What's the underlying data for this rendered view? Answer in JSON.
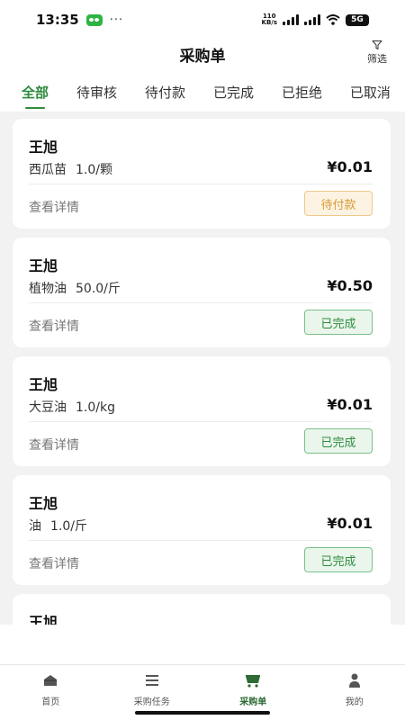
{
  "status_bar": {
    "time": "13:35",
    "dots": "···",
    "net_speed_value": "110",
    "net_speed_unit": "KB/s",
    "network": "5G"
  },
  "header": {
    "title": "采购单",
    "filter_label": "筛选"
  },
  "tabs": [
    {
      "label": "全部",
      "active": true
    },
    {
      "label": "待审核",
      "active": false
    },
    {
      "label": "待付款",
      "active": false
    },
    {
      "label": "已完成",
      "active": false
    },
    {
      "label": "已拒绝",
      "active": false
    },
    {
      "label": "已取消",
      "active": false
    }
  ],
  "orders": [
    {
      "buyer": "王旭",
      "product": "西瓜苗",
      "quantity": "1.0/颗",
      "price": "¥0.01",
      "detail_label": "查看详情",
      "status": "待付款"
    },
    {
      "buyer": "王旭",
      "product": "植物油",
      "quantity": "50.0/斤",
      "price": "¥0.50",
      "detail_label": "查看详情",
      "status": "已完成"
    },
    {
      "buyer": "王旭",
      "product": "大豆油",
      "quantity": "1.0/kg",
      "price": "¥0.01",
      "detail_label": "查看详情",
      "status": "已完成"
    },
    {
      "buyer": "王旭",
      "product": "油",
      "quantity": "1.0/斤",
      "price": "¥0.01",
      "detail_label": "查看详情",
      "status": "已完成"
    },
    {
      "buyer": "王旭"
    }
  ],
  "bottom_nav": [
    {
      "label": "首页",
      "icon": "home-icon",
      "active": false
    },
    {
      "label": "采购任务",
      "icon": "list-icon",
      "active": false
    },
    {
      "label": "采购单",
      "icon": "cart-icon",
      "active": true
    },
    {
      "label": "我的",
      "icon": "user-icon",
      "active": false
    }
  ],
  "colors": {
    "accent": "#2e8b3e",
    "pending_text": "#d59a35",
    "pending_bg": "#fdf3e2",
    "done_bg": "#eaf6ec"
  }
}
